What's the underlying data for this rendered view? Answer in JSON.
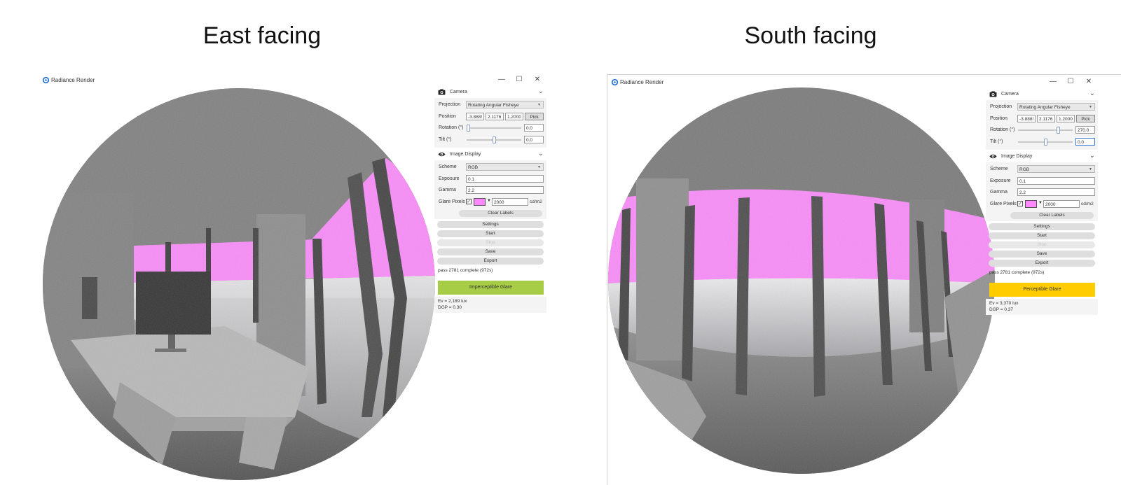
{
  "headings": {
    "east": "East facing",
    "south": "South facing"
  },
  "windows": [
    {
      "id": "east",
      "app_title": "Radiance Render",
      "controls": {
        "minimize": "—",
        "maximize": "☐",
        "close": "✕"
      },
      "camera": {
        "title": "Camera",
        "projection_label": "Projection",
        "projection_value": "Rotating Angular Fisheye",
        "position_label": "Position",
        "position_x": "-3.888!",
        "position_y": "2.1176",
        "position_z": "1.2000",
        "pick_label": "Pick",
        "rotation_label": "Rotation (°)",
        "rotation_value": "0.0",
        "rotation_fraction": 0.0,
        "tilt_label": "Tilt (°)",
        "tilt_value": "0.0",
        "tilt_fraction": 0.5
      },
      "image_display": {
        "title": "Image Display",
        "scheme_label": "Scheme",
        "scheme_value": "RGB",
        "exposure_label": "Exposure",
        "exposure_value": "0.1",
        "gamma_label": "Gamma",
        "gamma_value": "2.2",
        "glare_label": "Glare Pixels",
        "glare_checked": "✓",
        "glare_color": "#ff88ff",
        "glare_threshold": "2000",
        "glare_unit": "cd/m2",
        "clear_labels": "Clear Labels"
      },
      "buttons": {
        "settings": "Settings",
        "start": "Start",
        "stop": "Stop",
        "save": "Save",
        "export": "Export"
      },
      "status": "pass 2781 complete (972s)",
      "result_label": "Imperceptible Glare",
      "result_color": "#a6cd45",
      "ev": "Ev = 2,189 lux",
      "dgp": "DGP = 0.30"
    },
    {
      "id": "south",
      "app_title": "Radiance Render",
      "controls": {
        "minimize": "—",
        "maximize": "☐",
        "close": "✕"
      },
      "camera": {
        "title": "Camera",
        "projection_label": "Projection",
        "projection_value": "Rotating Angular Fisheye",
        "position_label": "Position",
        "position_x": "-3.888!",
        "position_y": "2.1176",
        "position_z": "1.2000",
        "pick_label": "Pick",
        "rotation_label": "Rotation (°)",
        "rotation_value": "270.0",
        "rotation_fraction": 0.75,
        "tilt_label": "Tilt (°)",
        "tilt_value": "0.0",
        "tilt_fraction": 0.5
      },
      "image_display": {
        "title": "Image Display",
        "scheme_label": "Scheme",
        "scheme_value": "RGB",
        "exposure_label": "Exposure",
        "exposure_value": "0.1",
        "gamma_label": "Gamma",
        "gamma_value": "2.2",
        "glare_label": "Glare Pixels",
        "glare_checked": "✓",
        "glare_color": "#ff88ff",
        "glare_threshold": "2000",
        "glare_unit": "cd/m2",
        "clear_labels": "Clear Labels"
      },
      "buttons": {
        "settings": "Settings",
        "start": "Start",
        "stop": "Stop",
        "save": "Save",
        "export": "Export"
      },
      "status": "pass 2781 complete (972s)",
      "result_label": "Perceptible Glare",
      "result_color": "#ffcc00",
      "ev": "Ev = 3,370 lux",
      "dgp": "DGP = 0.37"
    }
  ],
  "icons": {
    "app": "radiance-logo-icon",
    "camera": "camera-icon",
    "image_display": "eye-icon",
    "chevron": "chevron-down-icon"
  }
}
